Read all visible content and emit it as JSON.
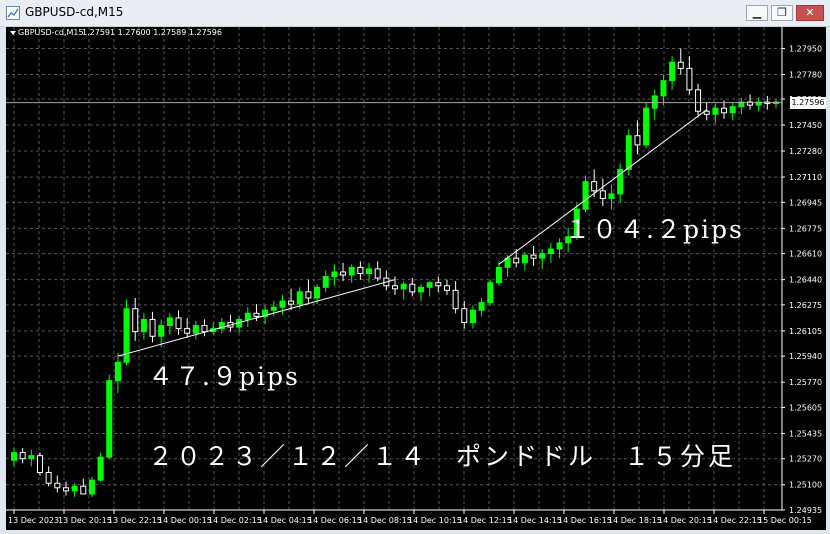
{
  "window": {
    "title": "GBPUSD-cd,M15",
    "controls": [
      "minimize",
      "maximize",
      "close"
    ]
  },
  "chart": {
    "symbol_label": "GBPUSD-cd,M15",
    "ohlc_text": "1.27591 1.27600 1.27589 1.27596",
    "current_price_tag": "1.27596",
    "annotations": {
      "a1": "４７.９pips",
      "a2": "１０４.２pips",
      "a3": "２０２３／１２／１４　ポンドドル　１５分足"
    },
    "colors": {
      "background": "#000000",
      "bull_candle": "#00ff00",
      "bear_candle": "#ffffff",
      "grid": "#555555",
      "trendline": "#ffffff"
    }
  },
  "chart_data": {
    "type": "candlestick",
    "title": "",
    "xlabel": "",
    "ylabel": "",
    "y_tick_labels": [
      "1.27950",
      "1.27780",
      "1.27620",
      "1.27450",
      "1.27280",
      "1.27110",
      "1.26945",
      "1.26775",
      "1.26610",
      "1.26440",
      "1.26275",
      "1.26105",
      "1.25940",
      "1.25770",
      "1.25605",
      "1.25435",
      "1.25270",
      "1.25100",
      "1.24935"
    ],
    "x_tick_labels": [
      "13 Dec 2023",
      "13 Dec 20:15",
      "13 Dec 22:15",
      "14 Dec 00:15",
      "14 Dec 02:15",
      "14 Dec 04:15",
      "14 Dec 06:15",
      "14 Dec 08:15",
      "14 Dec 10:15",
      "14 Dec 12:15",
      "14 Dec 14:15",
      "14 Dec 16:15",
      "14 Dec 18:15",
      "14 Dec 20:15",
      "14 Dec 22:15",
      "15 Dec 00:15"
    ],
    "ylim": [
      1.24935,
      1.28025
    ],
    "grid": true,
    "trendlines": [
      {
        "from_time": "13 Dec 20:15",
        "from_price": 1.2594,
        "to_time": "14 Dec 05:30",
        "to_price": 1.2644,
        "label": "４７.９pips"
      },
      {
        "from_time": "14 Dec 08:45",
        "from_price": 1.2654,
        "to_time": "14 Dec 19:00",
        "to_price": 1.2755,
        "label": "１０４.２pips"
      }
    ],
    "current_price": 1.27596,
    "x_axis_slots": [
      8,
      58,
      108,
      158,
      208,
      258,
      308,
      358,
      408,
      458,
      508,
      558,
      608,
      658,
      708,
      758
    ],
    "note": "OHLC candles: x index in chart slot units (0 = first visible bar)",
    "candles": [
      [
        1.2526,
        1.2534,
        1.2522,
        1.2531
      ],
      [
        1.2531,
        1.2534,
        1.2524,
        1.2527
      ],
      [
        1.2527,
        1.2533,
        1.2522,
        1.2529
      ],
      [
        1.2529,
        1.2531,
        1.2516,
        1.2518
      ],
      [
        1.2518,
        1.2522,
        1.2509,
        1.2511
      ],
      [
        1.2511,
        1.2516,
        1.2505,
        1.2508
      ],
      [
        1.2508,
        1.2512,
        1.2503,
        1.2506
      ],
      [
        1.2506,
        1.2511,
        1.2502,
        1.2509
      ],
      [
        1.2509,
        1.2514,
        1.2505,
        1.2504
      ],
      [
        1.2504,
        1.2515,
        1.2502,
        1.2513
      ],
      [
        1.2513,
        1.2531,
        1.2512,
        1.2528
      ],
      [
        1.2528,
        1.2582,
        1.2527,
        1.2578
      ],
      [
        1.2578,
        1.2596,
        1.257,
        1.259
      ],
      [
        1.259,
        1.2631,
        1.2588,
        1.2625
      ],
      [
        1.2625,
        1.2632,
        1.2604,
        1.261
      ],
      [
        1.261,
        1.2622,
        1.2605,
        1.2618
      ],
      [
        1.2618,
        1.2623,
        1.2603,
        1.2607
      ],
      [
        1.2607,
        1.2618,
        1.26,
        1.2614
      ],
      [
        1.2614,
        1.2622,
        1.2608,
        1.2619
      ],
      [
        1.2619,
        1.2624,
        1.2608,
        1.2612
      ],
      [
        1.2612,
        1.2619,
        1.2606,
        1.2609
      ],
      [
        1.2609,
        1.2617,
        1.2605,
        1.2614
      ],
      [
        1.2614,
        1.2618,
        1.2607,
        1.261
      ],
      [
        1.261,
        1.2616,
        1.2608,
        1.2612
      ],
      [
        1.2612,
        1.2619,
        1.2609,
        1.2616
      ],
      [
        1.2616,
        1.2621,
        1.261,
        1.2613
      ],
      [
        1.2613,
        1.262,
        1.2609,
        1.2618
      ],
      [
        1.2618,
        1.2626,
        1.2613,
        1.2622
      ],
      [
        1.2622,
        1.2628,
        1.2617,
        1.262
      ],
      [
        1.262,
        1.2627,
        1.2615,
        1.2624
      ],
      [
        1.2624,
        1.263,
        1.262,
        1.2626
      ],
      [
        1.2626,
        1.2634,
        1.2621,
        1.263
      ],
      [
        1.263,
        1.2638,
        1.2624,
        1.2628
      ],
      [
        1.2628,
        1.2639,
        1.2625,
        1.2636
      ],
      [
        1.2636,
        1.2644,
        1.2629,
        1.2632
      ],
      [
        1.2632,
        1.2641,
        1.2628,
        1.2639
      ],
      [
        1.2639,
        1.265,
        1.2636,
        1.2646
      ],
      [
        1.2646,
        1.2654,
        1.264,
        1.2649
      ],
      [
        1.2649,
        1.2655,
        1.2643,
        1.2647
      ],
      [
        1.2647,
        1.2654,
        1.2642,
        1.2652
      ],
      [
        1.2652,
        1.2656,
        1.2644,
        1.2648
      ],
      [
        1.2648,
        1.2655,
        1.2642,
        1.2651
      ],
      [
        1.2651,
        1.2656,
        1.2643,
        1.2645
      ],
      [
        1.2645,
        1.265,
        1.2637,
        1.264
      ],
      [
        1.264,
        1.2646,
        1.2634,
        1.2638
      ],
      [
        1.2638,
        1.2643,
        1.2631,
        1.2641
      ],
      [
        1.2641,
        1.2645,
        1.2633,
        1.2636
      ],
      [
        1.2636,
        1.2641,
        1.263,
        1.2639
      ],
      [
        1.2639,
        1.2643,
        1.2633,
        1.2642
      ],
      [
        1.2642,
        1.2646,
        1.2636,
        1.264
      ],
      [
        1.264,
        1.2644,
        1.2634,
        1.2637
      ],
      [
        1.2637,
        1.2643,
        1.2622,
        1.2625
      ],
      [
        1.2625,
        1.263,
        1.2612,
        1.2616
      ],
      [
        1.2616,
        1.2627,
        1.2612,
        1.2624
      ],
      [
        1.2624,
        1.2632,
        1.262,
        1.2629
      ],
      [
        1.2629,
        1.2644,
        1.2627,
        1.2642
      ],
      [
        1.2642,
        1.2656,
        1.264,
        1.2652
      ],
      [
        1.2652,
        1.266,
        1.2646,
        1.2658
      ],
      [
        1.2658,
        1.2664,
        1.2652,
        1.2655
      ],
      [
        1.2655,
        1.2662,
        1.265,
        1.266
      ],
      [
        1.266,
        1.2666,
        1.2653,
        1.2658
      ],
      [
        1.2658,
        1.2664,
        1.2651,
        1.2661
      ],
      [
        1.2661,
        1.2668,
        1.2655,
        1.2664
      ],
      [
        1.2664,
        1.2671,
        1.2658,
        1.2668
      ],
      [
        1.2668,
        1.2678,
        1.2662,
        1.2672
      ],
      [
        1.2672,
        1.2694,
        1.267,
        1.269
      ],
      [
        1.269,
        1.2712,
        1.2688,
        1.2708
      ],
      [
        1.2708,
        1.2716,
        1.2698,
        1.2702
      ],
      [
        1.2702,
        1.271,
        1.2692,
        1.2697
      ],
      [
        1.2697,
        1.2706,
        1.269,
        1.27
      ],
      [
        1.27,
        1.272,
        1.2694,
        1.2716
      ],
      [
        1.2716,
        1.2742,
        1.2712,
        1.2738
      ],
      [
        1.2738,
        1.2748,
        1.2726,
        1.2732
      ],
      [
        1.2732,
        1.276,
        1.273,
        1.2756
      ],
      [
        1.2756,
        1.2768,
        1.2748,
        1.2764
      ],
      [
        1.2764,
        1.2778,
        1.2758,
        1.2774
      ],
      [
        1.2774,
        1.279,
        1.2768,
        1.2786
      ],
      [
        1.2786,
        1.2795,
        1.2778,
        1.2782
      ],
      [
        1.2782,
        1.279,
        1.2765,
        1.2768
      ],
      [
        1.2768,
        1.2772,
        1.275,
        1.2754
      ],
      [
        1.2754,
        1.276,
        1.2748,
        1.2752
      ],
      [
        1.2752,
        1.2759,
        1.2746,
        1.2756
      ],
      [
        1.2756,
        1.2761,
        1.2749,
        1.2753
      ],
      [
        1.2753,
        1.276,
        1.2748,
        1.2757
      ],
      [
        1.2757,
        1.2763,
        1.2752,
        1.276
      ],
      [
        1.276,
        1.2765,
        1.2755,
        1.2758
      ],
      [
        1.2758,
        1.2763,
        1.2754,
        1.276
      ],
      [
        1.276,
        1.2764,
        1.2755,
        1.2759
      ],
      [
        1.2759,
        1.2762,
        1.2756,
        1.276
      ]
    ]
  }
}
